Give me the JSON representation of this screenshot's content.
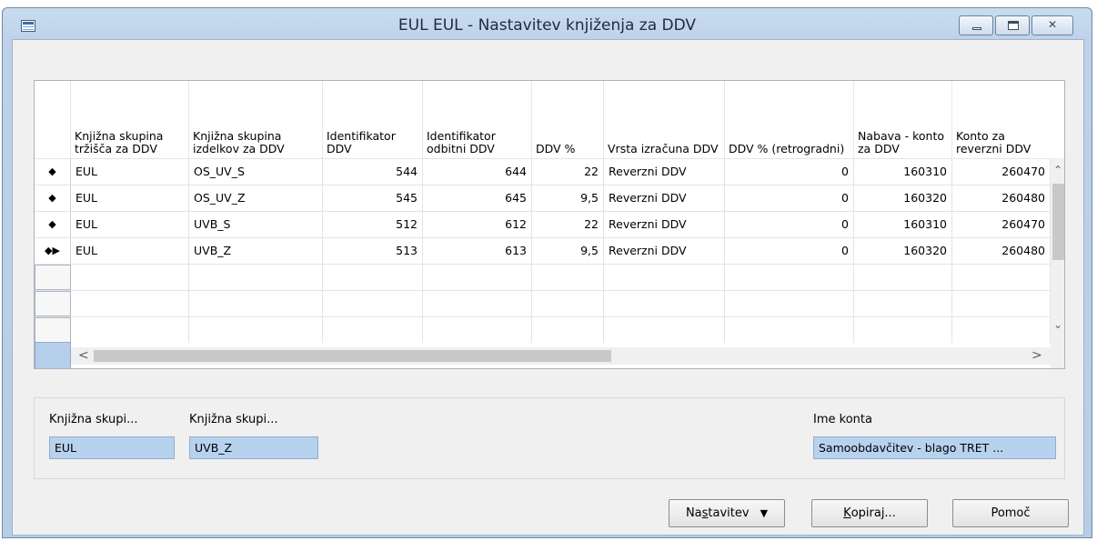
{
  "window": {
    "title": "EUL EUL - Nastavitev knjiženja za DDV",
    "app_icon": "table-form-icon",
    "minimize_icon": "minimize-icon",
    "maximize_icon": "maximize-icon",
    "close_icon": "close-icon",
    "close_glyph": "✕"
  },
  "grid": {
    "columns": [
      "Knjižna skupina tržišča za DDV",
      "Knjižna skupina izdelkov za DDV",
      "Identifikator DDV",
      "Identifikator odbitni DDV",
      "DDV %",
      "Vrsta izračuna DDV",
      "DDV % (retrogradni)",
      "Nabava - konto za DDV",
      "Konto za reverzni DDV"
    ],
    "rows": [
      {
        "marker": "◆",
        "c1": "EUL",
        "c2": "OS_UV_S",
        "c3": "544",
        "c4": "644",
        "c5": "22",
        "c6": "Reverzni DDV",
        "c7": "0",
        "c8": "160310",
        "c9": "260470"
      },
      {
        "marker": "◆",
        "c1": "EUL",
        "c2": "OS_UV_Z",
        "c3": "545",
        "c4": "645",
        "c5": "9,5",
        "c6": "Reverzni DDV",
        "c7": "0",
        "c8": "160320",
        "c9": "260480"
      },
      {
        "marker": "◆",
        "c1": "EUL",
        "c2": "UVB_S",
        "c3": "512",
        "c4": "612",
        "c5": "22",
        "c6": "Reverzni DDV",
        "c7": "0",
        "c8": "160310",
        "c9": "260470"
      },
      {
        "marker": "◆▶",
        "c1": "EUL",
        "c2": "UVB_Z",
        "c3": "513",
        "c4": "613",
        "c5": "9,5",
        "c6": "Reverzni DDV",
        "c7": "0",
        "c8": "160320",
        "c9": "260480"
      }
    ],
    "scroll_up": "⌃",
    "scroll_down": "⌄",
    "scroll_left": "<",
    "scroll_right": ">"
  },
  "details": {
    "field1_label": "Knjižna skupi...",
    "field1_value": "EUL",
    "field2_label": "Knjižna skupi...",
    "field2_value": "UVB_Z",
    "field3_label": "Ime konta",
    "field3_value": "Samoobdavčitev - blago TRET ..."
  },
  "buttons": {
    "setup_pre": "Na",
    "setup_ul": "s",
    "setup_post": "tavitev",
    "setup_arrow": "▼",
    "copy_ul": "K",
    "copy_post": "opiraj...",
    "help": "Pomoč"
  }
}
